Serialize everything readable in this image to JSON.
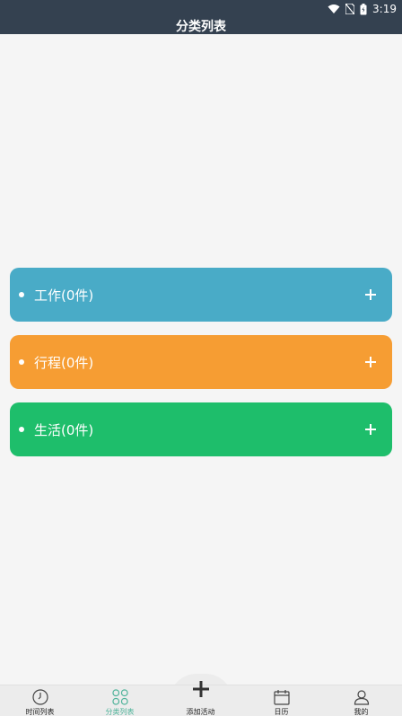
{
  "status": {
    "time": "3:19"
  },
  "header": {
    "title": "分类列表"
  },
  "categories": [
    {
      "label": "工作(0件)",
      "color": "#49abc7"
    },
    {
      "label": "行程(0件)",
      "color": "#f69d33"
    },
    {
      "label": "生活(0件)",
      "color": "#1ebe6b"
    }
  ],
  "tabs": [
    {
      "label": "时间列表",
      "icon": "clock-icon"
    },
    {
      "label": "分类列表",
      "icon": "grid-icon",
      "active": true
    },
    {
      "label": "添加活动",
      "icon": "plus-icon"
    },
    {
      "label": "日历",
      "icon": "calendar-icon"
    },
    {
      "label": "我的",
      "icon": "user-icon"
    }
  ],
  "colors": {
    "header": "#344150",
    "active_tab": "#4fb39a"
  }
}
